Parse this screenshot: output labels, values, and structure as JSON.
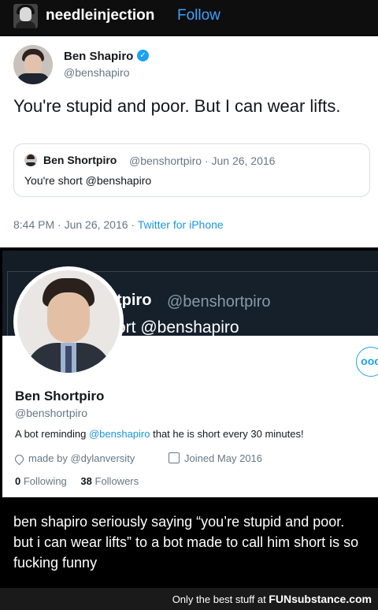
{
  "tumblr": {
    "username": "needleinjection",
    "follow_label": "Follow"
  },
  "tweet": {
    "author_name": "Ben Shapiro",
    "author_handle": "@benshapiro",
    "verified_icon": "verified-badge-icon",
    "text": "You're stupid and poor. But I can wear lifts.",
    "quoted": {
      "author_name": "Ben Shortpiro",
      "meta": "@benshortpiro · Jun 26, 2016",
      "text": "You're short @benshapiro"
    },
    "time": "8:44 PM · Jun 26, 2016 ·",
    "source": "Twitter for iPhone"
  },
  "profile": {
    "banner_name": "tpiro",
    "banner_handle": "@benshortpiro",
    "banner_tweet": "ort @benshapiro",
    "more_label": "ooo",
    "name": "Ben Shortpiro",
    "handle": "@benshortpiro",
    "bio_before": "A bot reminding ",
    "bio_link": "@benshapiro",
    "bio_after": " that he is short every 30 minutes!",
    "location": "made by @dylanversity",
    "joined": "Joined May 2016",
    "following_count": "0",
    "following_label": "Following",
    "followers_count": "38",
    "followers_label": "Followers"
  },
  "caption": "ben shapiro seriously saying “you’re stupid and poor. but i can wear lifts” to a bot made to call him short is so fucking funny",
  "footer": {
    "text": "Only the best stuff at ",
    "brand": "FUNsubstance.com"
  },
  "colors": {
    "twitter_blue": "#1da1f2",
    "tumblr_follow": "#3ea0ff",
    "dark_banner": "#15202b"
  }
}
